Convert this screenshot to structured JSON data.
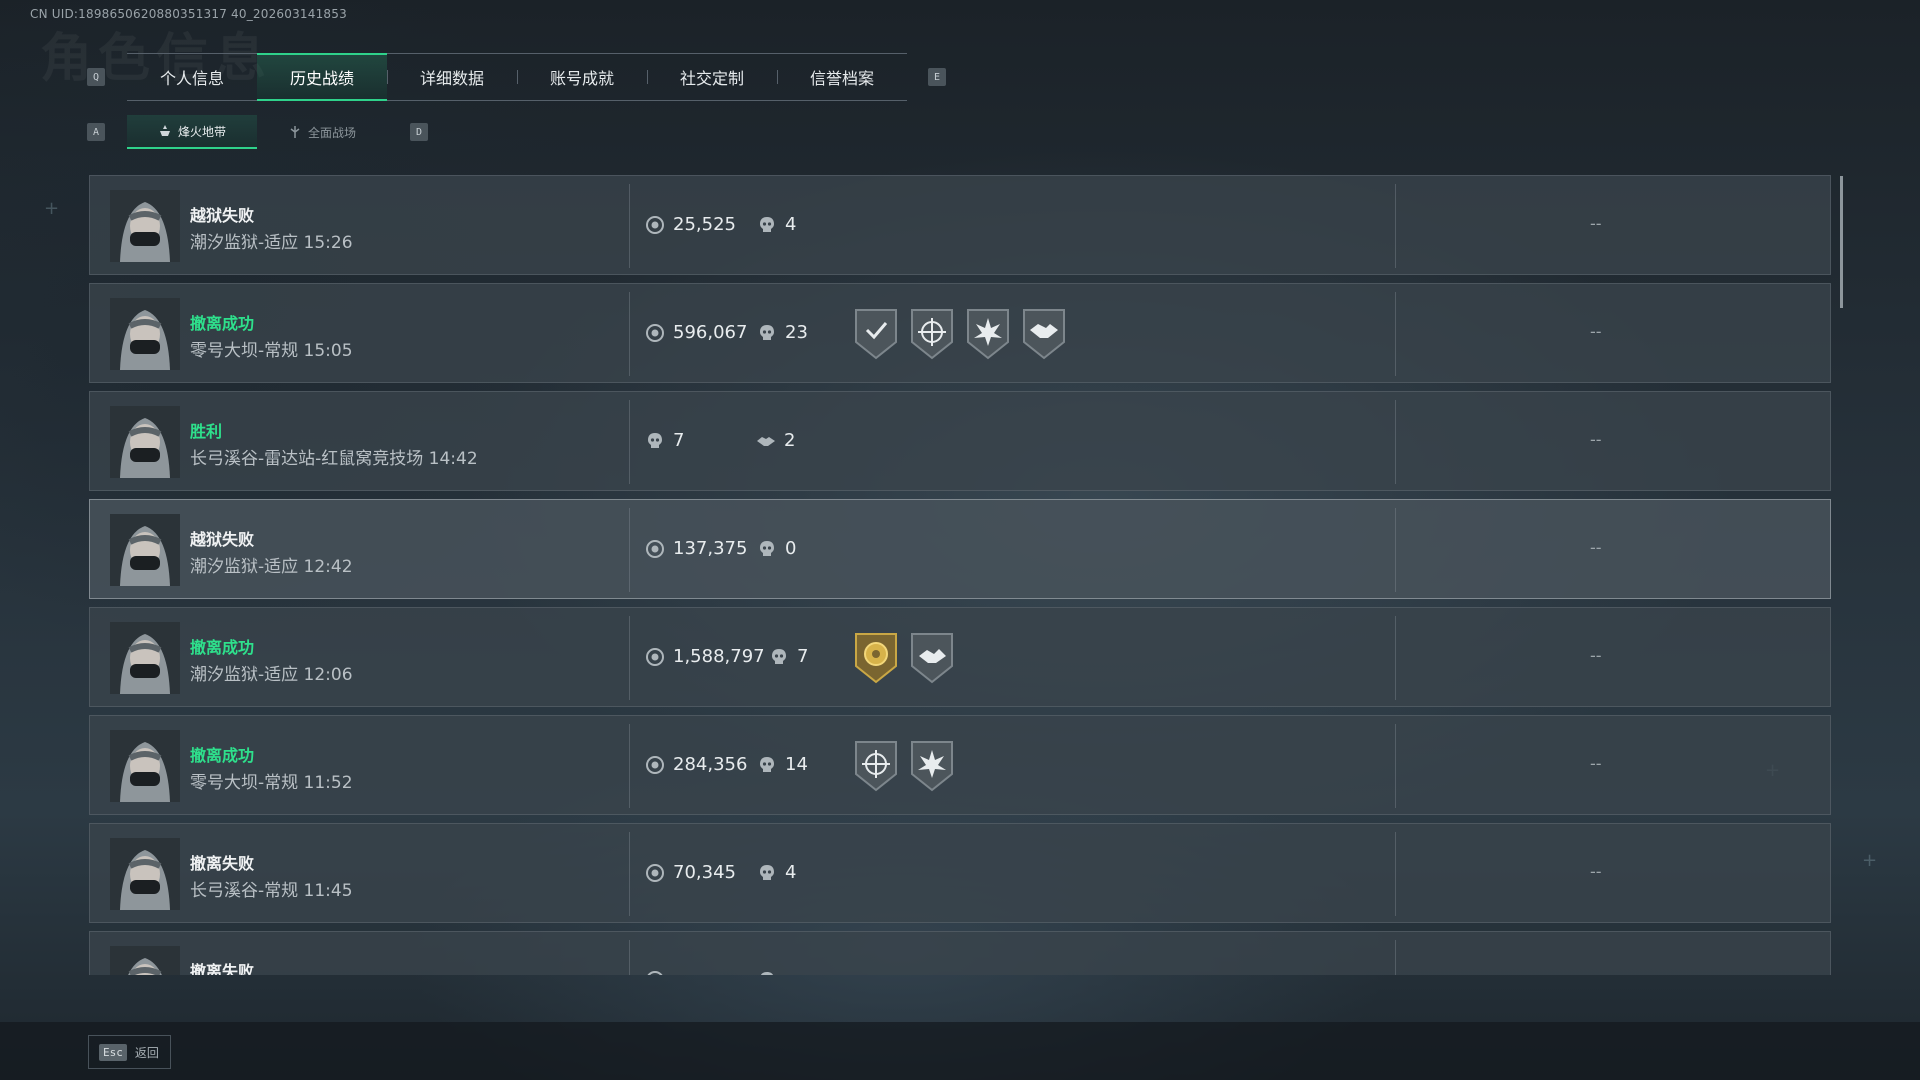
{
  "uid": "CN UID:1898650620880351317 40_202603141853",
  "bg_title": "角色信息",
  "keys": {
    "prev_tab": "Q",
    "next_tab": "E",
    "prev_sub": "A",
    "next_sub": "D"
  },
  "tabs": [
    {
      "label": "个人信息",
      "active": false
    },
    {
      "label": "历史战绩",
      "active": true
    },
    {
      "label": "详细数据",
      "active": false
    },
    {
      "label": "账号成就",
      "active": false
    },
    {
      "label": "社交定制",
      "active": false
    },
    {
      "label": "信誉档案",
      "active": false
    }
  ],
  "subtabs": [
    {
      "label": "烽火地带",
      "active": true
    },
    {
      "label": "全面战场",
      "active": false
    }
  ],
  "matches": [
    {
      "result": "越狱失败",
      "status": "fail",
      "map": "潮汐监狱-适应 15:26",
      "value": "25,525",
      "kills": "4",
      "badges": [],
      "right": "--"
    },
    {
      "result": "撤离成功",
      "status": "success",
      "map": "零号大坝-常规 15:05",
      "value": "596,067",
      "kills": "23",
      "badges": [
        "shield-check-badge",
        "crosshair-badge",
        "explosion-badge",
        "handshake-badge"
      ],
      "right": "--"
    },
    {
      "result": "胜利",
      "status": "success",
      "map": "长弓溪谷-雷达站-红鼠窝竞技场 14:42",
      "kills": "7",
      "assists": "2",
      "badges": [],
      "right": "--"
    },
    {
      "result": "越狱失败",
      "status": "fail",
      "map": "潮汐监狱-适应 12:42",
      "value": "137,375",
      "kills": "0",
      "badges": [],
      "right": "--"
    },
    {
      "result": "撤离成功",
      "status": "success",
      "map": "潮汐监狱-适应 12:06",
      "value": "1,588,797",
      "kills": "7",
      "badges": [
        "gold-coin-badge",
        "deal-badge"
      ],
      "right": "--"
    },
    {
      "result": "撤离成功",
      "status": "success",
      "map": "零号大坝-常规 11:52",
      "value": "284,356",
      "kills": "14",
      "badges": [
        "crosshair-badge",
        "explosion-badge"
      ],
      "right": "--"
    },
    {
      "result": "撤离失败",
      "status": "fail",
      "map": "长弓溪谷-常规 11:45",
      "value": "70,345",
      "kills": "4",
      "badges": [],
      "right": "--"
    },
    {
      "result": "撤离失败",
      "status": "fail",
      "map": "",
      "value": "",
      "kills": "",
      "badges": [],
      "right": ""
    }
  ],
  "footer": {
    "esc_key": "Esc",
    "esc_label": "返回"
  },
  "colors": {
    "accent": "#2fd28b",
    "success_text": "#2ee08c"
  }
}
